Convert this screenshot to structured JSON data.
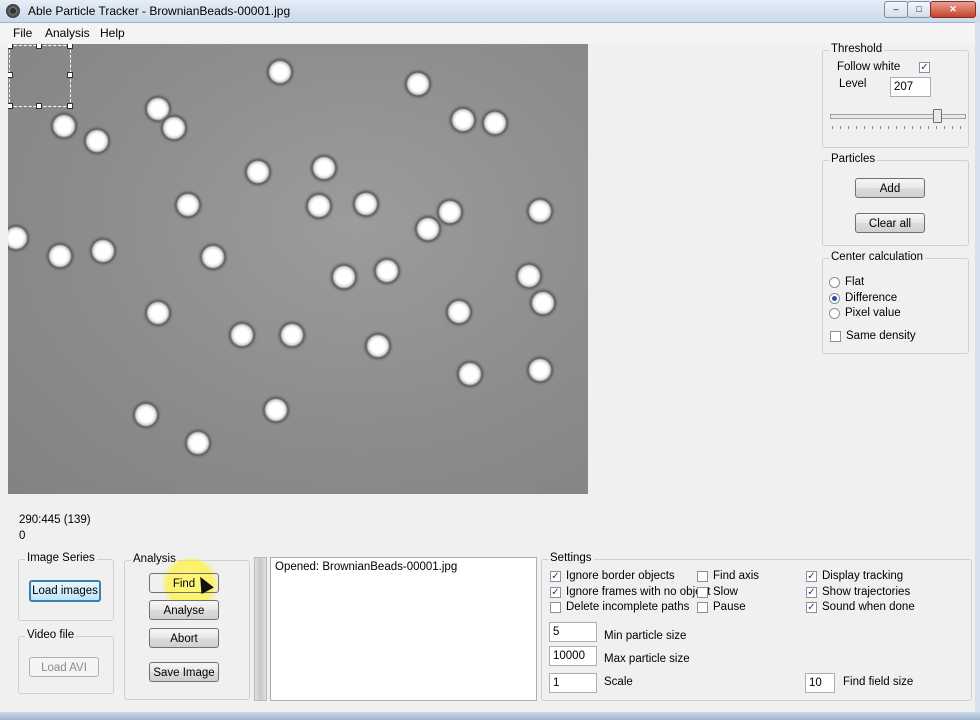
{
  "window": {
    "title": "Able Particle Tracker - BrownianBeads-00001.jpg",
    "controls": {
      "minimize": "–",
      "maximize": "□",
      "close": "✕"
    }
  },
  "menu": [
    "File",
    "Analysis",
    "Help"
  ],
  "status": {
    "coords": "290:445 (139)",
    "value": "0"
  },
  "threshold": {
    "title": "Threshold",
    "follow_white_label": "Follow white",
    "follow_white_checked": true,
    "level_label": "Level",
    "level_value": "207",
    "slider_fraction": 0.81
  },
  "particles": {
    "title": "Particles",
    "add": "Add",
    "clear_all": "Clear all"
  },
  "center_calculation": {
    "title": "Center calculation",
    "options": [
      "Flat",
      "Difference",
      "Pixel value"
    ],
    "selected": "Difference",
    "same_density_label": "Same density",
    "same_density_checked": false
  },
  "image_series": {
    "title": "Image Series",
    "load_images": "Load images"
  },
  "video_file": {
    "title": "Video file",
    "load_avi": "Load AVI"
  },
  "analysis": {
    "title": "Analysis",
    "find": "Find",
    "analyse": "Analyse",
    "abort": "Abort",
    "save_image": "Save Image"
  },
  "log": {
    "lines": [
      "Opened: BrownianBeads-00001.jpg"
    ]
  },
  "settings": {
    "title": "Settings",
    "col1": [
      {
        "label": "Ignore border objects",
        "checked": true
      },
      {
        "label": "Ignore frames with no object",
        "checked": true
      },
      {
        "label": "Delete incomplete paths",
        "checked": false
      }
    ],
    "col2": [
      {
        "label": "Find axis",
        "checked": false
      },
      {
        "label": "Slow",
        "checked": false
      },
      {
        "label": "Pause",
        "checked": false
      }
    ],
    "col3": [
      {
        "label": "Display tracking",
        "checked": true
      },
      {
        "label": "Show trajectories",
        "checked": true
      },
      {
        "label": "Sound when done",
        "checked": true
      }
    ],
    "min_particle_size": {
      "label": "Min particle size",
      "value": "5"
    },
    "max_particle_size": {
      "label": "Max particle size",
      "value": "10000"
    },
    "scale": {
      "label": "Scale",
      "value": "1"
    },
    "find_field_size": {
      "label": "Find field size",
      "value": "10"
    }
  },
  "check_glyph": "✓",
  "colors": {
    "image_bg": "#8c8c8c",
    "bead_core": "#ffffff",
    "bead_ring": "#4a4a4a",
    "highlight": "#fff34a",
    "accent": "#3c7fb1"
  }
}
